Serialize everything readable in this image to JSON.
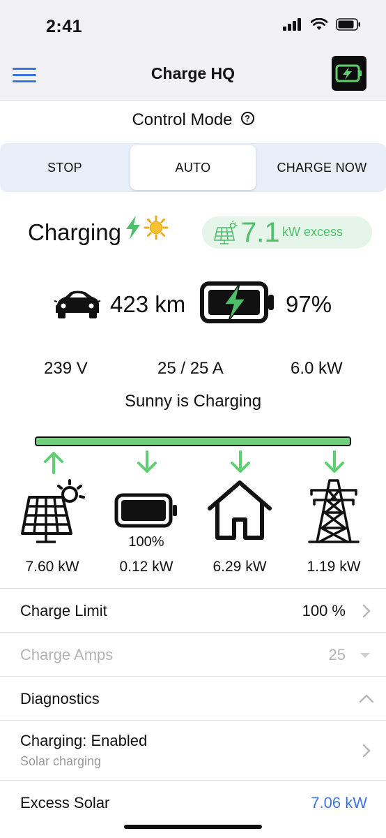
{
  "status_bar": {
    "time": "2:41"
  },
  "nav": {
    "title": "Charge HQ"
  },
  "control_mode": {
    "title": "Control Mode",
    "help_icon": "question-circle-icon",
    "options": [
      "STOP",
      "AUTO",
      "CHARGE NOW"
    ],
    "selected": "AUTO"
  },
  "charging": {
    "status": "Charging",
    "excess_value": "7.1",
    "excess_unit": "kW excess",
    "range": "423 km",
    "soc": "97%",
    "voltage": "239 V",
    "amps": "25 / 25 A",
    "power": "6.0 kW",
    "sub_status": "Sunny is Charging"
  },
  "flow": [
    {
      "name": "solar",
      "icon": "solar-panel-sun-icon",
      "direction": "up",
      "value": "7.60 kW"
    },
    {
      "name": "home-battery",
      "icon": "battery-icon",
      "direction": "down",
      "value": "0.12 kW",
      "level": "100%"
    },
    {
      "name": "house",
      "icon": "house-icon",
      "direction": "down",
      "value": "6.29 kW"
    },
    {
      "name": "grid",
      "icon": "power-pylon-icon",
      "direction": "down",
      "value": "1.19 kW"
    }
  ],
  "settings": {
    "charge_limit_label": "Charge Limit",
    "charge_limit_value": "100 %",
    "charge_amps_label": "Charge Amps",
    "charge_amps_value": "25",
    "diagnostics_label": "Diagnostics",
    "charging_enabled_label": "Charging: Enabled",
    "charging_enabled_sub": "Solar charging",
    "excess_solar_label": "Excess Solar",
    "excess_solar_value": "7.06 kW"
  },
  "colors": {
    "accent_blue": "#3b73e0",
    "green": "#4fbf6a",
    "flow_bar": "#6fd07d",
    "segment_bg": "#e8eef8",
    "pill_bg": "#e6f5ea"
  }
}
